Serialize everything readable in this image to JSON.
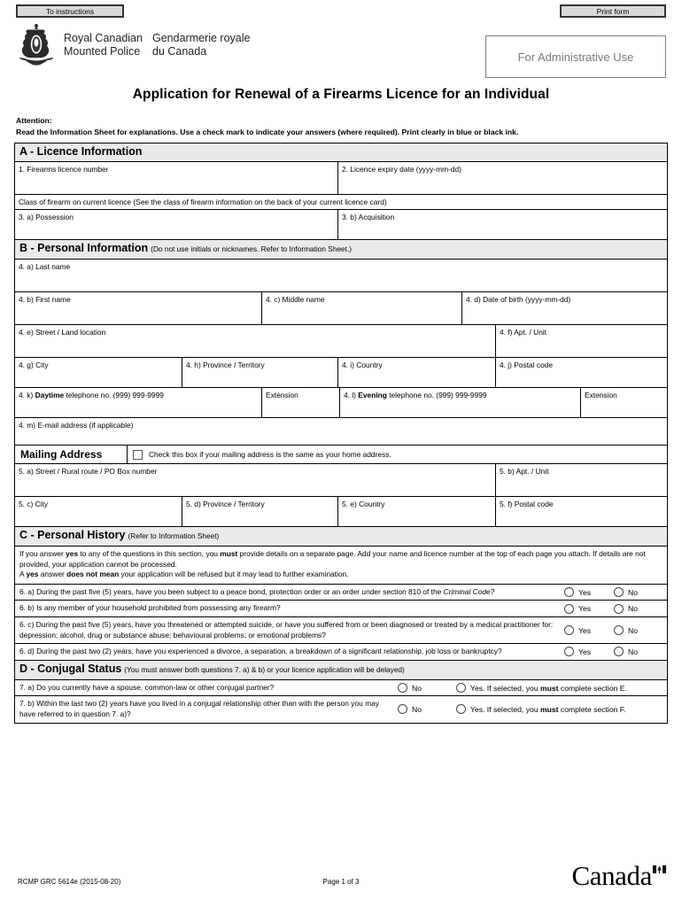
{
  "toolbar": {
    "instructions_label": "To instructions",
    "print_label": "Print form"
  },
  "header": {
    "org_en_line1": "Royal Canadian",
    "org_en_line2": "Mounted Police",
    "org_fr_line1": "Gendarmerie royale",
    "org_fr_line2": "du Canada",
    "admin_box_label": "For Administrative Use"
  },
  "title": "Application for Renewal of a Firearms Licence for an Individual",
  "attention": {
    "heading": "Attention:",
    "body": "Read the Information Sheet for explanations. Use a check mark to indicate your answers (where required). Print clearly in blue or black ink."
  },
  "section_a": {
    "heading": "A - Licence Information",
    "q1": "1. Firearms licence number",
    "q2": "2. Licence expiry date (yyyy-mm-dd)",
    "class_note": "Class of firearm on current licence (See the class of firearm information on the back of your current licence card)",
    "q3a": "3. a) Possession",
    "q3b": "3. b) Acquisition"
  },
  "section_b": {
    "heading": "B - Personal Information",
    "heading_note": "(Do not use initials or nicknames. Refer to Information Sheet.)",
    "q4a": "4. a) Last name",
    "q4b": "4. b) First name",
    "q4c": "4. c) Middle name",
    "q4d": "4. d) Date of birth (yyyy-mm-dd)",
    "q4e": "4. e) Street / Land location",
    "q4f": "4. f) Apt. / Unit",
    "q4g": "4. g) City",
    "q4h": "4. h) Province / Territory",
    "q4i": "4. i) Country",
    "q4j": "4. j) Postal code",
    "q4k_prefix": "4. k) ",
    "q4k_bold": "Daytime",
    "q4k_suffix": " telephone no. (999) 999-9999",
    "ext1": "Extension",
    "q4l_prefix": "4. l) ",
    "q4l_bold": "Evening",
    "q4l_suffix": " telephone no. (999) 999-9999",
    "ext2": "Extension",
    "q4m": "4. m) E-mail address (if applicable)"
  },
  "mailing": {
    "title": "Mailing Address",
    "checkbox_label": "Check this box if your mailing address is the same as your home address.",
    "q5a": "5. a) Street / Rural route / PO Box number",
    "q5b": "5. b) Apt. / Unit",
    "q5c": "5. c) City",
    "q5d": "5. d) Province / Territory",
    "q5e": "5. e) Country",
    "q5f": "5. f) Postal code"
  },
  "section_c": {
    "heading": "C - Personal History",
    "heading_note": "(Refer to Information Sheet)",
    "instructions_p1_a": "If you answer ",
    "instructions_p1_b": "yes",
    "instructions_p1_c": " to any of the questions in this section, you ",
    "instructions_p1_d": "must",
    "instructions_p1_e": " provide details on a separate page. Add your name and licence number at the top of each page you attach. If details are not provided, your application cannot be processed.",
    "instructions_p2_a": "A ",
    "instructions_p2_b": "yes",
    "instructions_p2_c": " answer ",
    "instructions_p2_d": "does not mean",
    "instructions_p2_e": " your application will be refused but it may lead to further examination.",
    "q6a_main": "6. a) During the past five (5) years, have you been subject to a peace bond, protection order or an order under section 810 of the ",
    "q6a_italic": "Criminal Code?",
    "q6b": "6. b) Is any member of your household prohibited from possessing any firearm?",
    "q6c": "6. c) During the past five (5) years, have you threatened or attempted suicide, or have you suffered from or been diagnosed or treated by a medical practitioner for: depression; alcohol, drug or substance abuse; behavioural problems; or emotional problems?",
    "q6d": "6. d) During the past two (2) years, have you experienced a divorce, a separation, a breakdown of a significant relationship, job loss or bankruptcy?",
    "yes_label": "Yes",
    "no_label": "No"
  },
  "section_d": {
    "heading": "D - Conjugal Status",
    "heading_note": "(You must answer both questions 7. a) & b) or your licence application will be delayed)",
    "q7a": "7. a) Do you currently have a spouse, common-law or other conjugal partner?",
    "q7b": "7. b) Within the last two (2) years have you lived in a conjugal relationship other than with the person you may have referred to in question 7. a)?",
    "no_label": "No",
    "yes_e_prefix": "Yes. If selected, you ",
    "yes_bold": "must",
    "yes_e_suffix": " complete section E.",
    "yes_f_suffix": " complete section F."
  },
  "footer": {
    "form_id": "RCMP GRC 5614e (2015-08-20)",
    "page_label": "Page 1 of 3",
    "wordmark": "Canada"
  }
}
